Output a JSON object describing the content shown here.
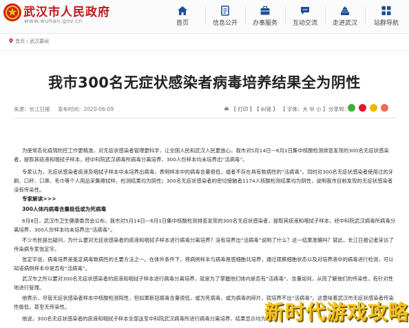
{
  "site": {
    "title": "武汉市人民政府",
    "url": "www.wuhan.gov.cn"
  },
  "nav": [
    {
      "label": "首页",
      "icon": "home-icon"
    },
    {
      "label": "信息公开",
      "icon": "document-icon"
    },
    {
      "label": "办事服务",
      "icon": "briefcase-icon"
    },
    {
      "label": "互动交流",
      "icon": "chat-icon"
    },
    {
      "label": "走进武汉",
      "icon": "building-icon"
    },
    {
      "label": "站群导航",
      "icon": "grid-icon"
    }
  ],
  "breadcrumb": {
    "home": "首页",
    "sep": "/",
    "section": "武汉要闻"
  },
  "article": {
    "title": "我市300名无症状感染者病毒培养结果全为阴性",
    "source": "来源：长江日报",
    "date": "发布时间：2020-06-09",
    "tools": {
      "print": "【 打印 】",
      "correction": "【 纠错 】",
      "font_size": "【 字体：大 中 小 】"
    },
    "share_label": "分享到：",
    "paragraphs": [
      "为使常态化疫情防控工作更精准，对无症状感染者管理更科学，让全国人民和武汉人民更放心，我市对5月14日—6月1日集中核酸检测排查发现的300名无症状感染者，提取其痰液和咽拭子样本，经中科院武汉病毒所病毒分离培养，300人份样本均未培养出“活病毒”。",
      "专家认为，无症状感染者痰液及咽拭子样本中未培养出病毒，表明样本中的病毒含量很低，或者不存在具有致病性的“活病毒”。同时对300名无症状感染者使用过的牙刷、口杯、口罩、毛巾等个人用品采集擦拭样，检测结果均为阴性；300名无症状感染者的密切接触者1174人核酸检测结果均为阴性，说明我市目前发现的无症状感染者没有传染性。",
      "6月8日，武汉市卫生健康委员会公布，我市对5月14日—6月1日集中核酸检测排查发现的300名无症状感染者，提取其痰液和咽拭子样本，经中科院武汉病毒所病毒分离培养，300人份样本均未培养出“活病毒”。",
      "不少市民提出疑问，为什么要对无症状感染者的痰液和咽拭子样本进行病毒分离培养？没有培养出“活病毒”说明了什么？这一结果准确吗？就此，长江日报记者采访了传染病专家张定宇。",
      "张定宇说，病毒培养是鉴定病毒致病性的主要方法之一。在体外条件下，将病例样本与病毒易感细胞共培养，通过观察细胞状态以及对培养液中的病毒进行检测，可以知道病例样本中是否有“活病毒”。",
      "武汉市之所以要对300名无症状感染者的痰液和咽拭子样本进行病毒分离培养，就是为了掌握他们体内是否有“活病毒”、含量如何，从而了解他们的传染性，有针对性地进行管理。",
      "他表示，尽管无症状感染者样本中核酸检测阳性，但如果新冠病毒含量很低，或为死病毒，或为病毒的碎片，就培养不出“活病毒”。这意味着武汉市无症状感染者传染性极低，甚至无传染性。",
      "他说，300名无症状感染者的痰液和咽拭子样本全部送至中科院武汉病毒所进行病毒分离培养，结果显示均为阴性。"
    ],
    "subhead_1": "专家解读>>>",
    "subhead_2": "300人体内病毒含量极低或为死病毒"
  },
  "watermark": "新时代游戏攻略",
  "colors": {
    "brand_red": "#c0161b",
    "wechat": "#3cb034",
    "weibo": "#e6162d",
    "qzone": "#f4b400"
  }
}
